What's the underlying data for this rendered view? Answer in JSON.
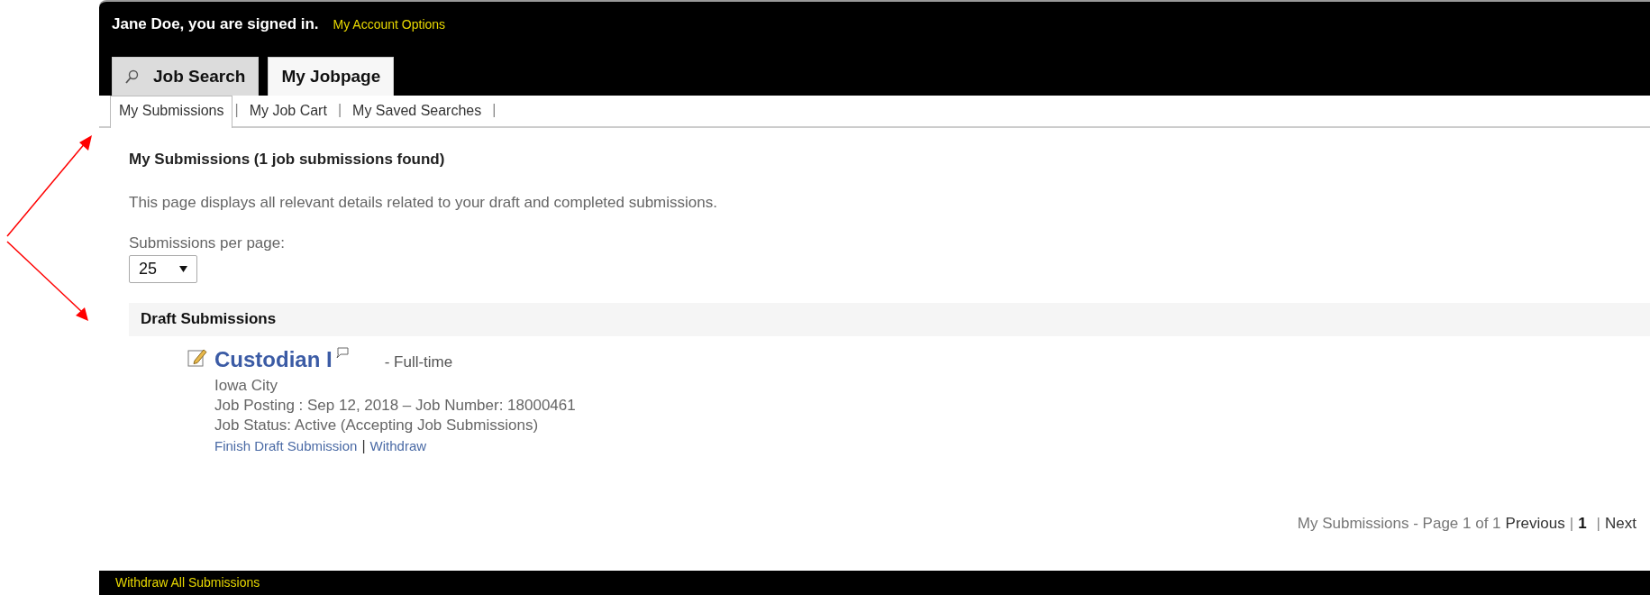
{
  "header": {
    "greeting": "Jane Doe, you are signed in.",
    "account_link": "My Account Options"
  },
  "tabs": [
    {
      "label": "Job Search",
      "kind": "search",
      "selected": false
    },
    {
      "label": "My Jobpage",
      "kind": "plain",
      "selected": true
    }
  ],
  "subtabs": [
    {
      "label": "My Submissions",
      "selected": true,
      "separator": "|"
    },
    {
      "label": "My Job Cart",
      "selected": false,
      "separator": "|"
    },
    {
      "label": "My Saved Searches",
      "selected": false,
      "separator": "|"
    }
  ],
  "page": {
    "heading": "My Submissions (1 job submissions found)",
    "description": "This page displays all relevant details related to your draft and completed submissions.",
    "per_page_label": "Submissions per page:",
    "per_page_value": "25"
  },
  "sections": [
    {
      "title": "Draft Submissions",
      "items": [
        {
          "title": "Custodian I",
          "type": "- Full-time",
          "location": "Iowa City",
          "posting": "Job Posting : Sep 12, 2018 – Job Number: 18000461",
          "status": "Job Status: Active (Accepting Job Submissions)",
          "actions": [
            "Finish Draft Submission",
            "Withdraw"
          ],
          "action_separators": [
            "|"
          ]
        }
      ]
    }
  ],
  "pagination": {
    "summary": "My Submissions - Page 1 of 1",
    "previous": "Previous",
    "separators": [
      "|",
      "|"
    ],
    "pages": [
      {
        "label": "1",
        "selected": true
      }
    ],
    "next": "Next"
  },
  "footer": {
    "link": "Withdraw All Submissions"
  },
  "annotations": [
    {
      "kind": "arrow"
    },
    {
      "kind": "arrow"
    }
  ]
}
